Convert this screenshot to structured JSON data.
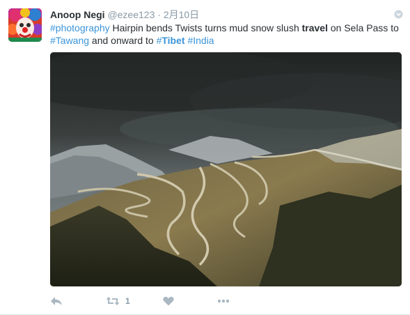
{
  "tweet": {
    "author": {
      "name": "Anoop Negi",
      "handle": "@ezee123"
    },
    "separator": "·",
    "timestamp": "2月10日",
    "text": {
      "hashtag1": "#photography",
      "t1": " Hairpin bends Twists turns mud snow slush ",
      "strong1": "travel",
      "t2": " on Sela Pass to ",
      "hashtag2": "#Tawang",
      "t3": " and onward to ",
      "hashtag3_prefix": "#",
      "hashtag3_word": "Tibet",
      "t4": " ",
      "hashtag4": "#India"
    },
    "actions": {
      "reply_icon": "reply-icon",
      "retweet_icon": "retweet-icon",
      "retweet_count": "1",
      "like_icon": "heart-icon",
      "more_icon": "more-icon"
    }
  },
  "colors": {
    "link": "#3b94d9",
    "muted": "#8899a6",
    "icon": "#aab8c2",
    "text": "#292f33"
  }
}
